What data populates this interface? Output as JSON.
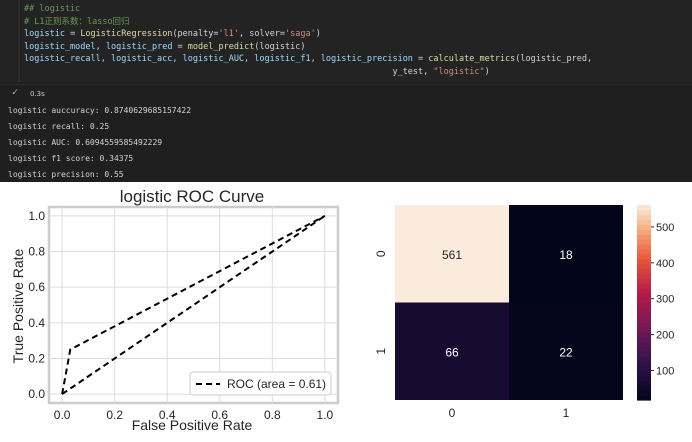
{
  "code": {
    "lines": [
      [
        {
          "t": "## logistic",
          "c": "cm"
        }
      ],
      [
        {
          "t": "# L1正则系数：lasso回归",
          "c": "cm"
        }
      ],
      [
        {
          "t": "logistic",
          "c": "kw"
        },
        {
          "t": " = ",
          "c": "pl"
        },
        {
          "t": "LogisticRegression",
          "c": "fn"
        },
        {
          "t": "(penalty=",
          "c": "pl"
        },
        {
          "t": "'l1'",
          "c": "str"
        },
        {
          "t": ", solver=",
          "c": "pl"
        },
        {
          "t": "'saga'",
          "c": "str"
        },
        {
          "t": ")",
          "c": "pl"
        }
      ],
      [
        {
          "t": "logistic_model",
          "c": "kw"
        },
        {
          "t": ", ",
          "c": "pl"
        },
        {
          "t": "logistic_pred",
          "c": "kw"
        },
        {
          "t": " = ",
          "c": "pl"
        },
        {
          "t": "model_predict",
          "c": "fn"
        },
        {
          "t": "(logistic)",
          "c": "pl"
        }
      ],
      [
        {
          "t": "logistic_recall, logistic_acc, logistic_AUC, logistic_f1, logistic_precision",
          "c": "kw"
        },
        {
          "t": " = ",
          "c": "pl"
        },
        {
          "t": "calculate_metrics",
          "c": "fn"
        },
        {
          "t": "(logistic_pred,",
          "c": "pl"
        }
      ],
      [
        {
          "t": "                                                                        y_test, ",
          "c": "pl"
        },
        {
          "t": "\"logistic\"",
          "c": "str"
        },
        {
          "t": ")",
          "c": "pl"
        }
      ]
    ]
  },
  "status": {
    "time": "0.3s"
  },
  "output": {
    "lines": [
      "logistic auccuracy: 0.8740629685157422",
      "logistic recall: 0.25",
      "logistic AUC: 0.6094559585492229",
      "logistic f1 score: 0.34375",
      "logistic precision: 0.55"
    ]
  },
  "chart_data": [
    {
      "type": "line",
      "title": "logistic ROC Curve",
      "xlabel": "False Positive Rate",
      "ylabel": "True Positive Rate",
      "xlim": [
        -0.05,
        1.05
      ],
      "ylim": [
        -0.05,
        1.05
      ],
      "xticks": [
        "0.0",
        "0.2",
        "0.4",
        "0.6",
        "0.8",
        "1.0"
      ],
      "yticks": [
        "0.0",
        "0.2",
        "0.4",
        "0.6",
        "0.8",
        "1.0"
      ],
      "grid": true,
      "legend_position": "lower-right",
      "series": [
        {
          "name": "ROC (area = 0.61)",
          "x": [
            0,
            0.031,
            1
          ],
          "y": [
            0,
            0.25,
            1
          ],
          "style": "dashed"
        },
        {
          "x": [
            0,
            1
          ],
          "y": [
            0,
            1
          ],
          "style": "dashed"
        }
      ]
    },
    {
      "type": "heatmap",
      "x_categories": [
        "0",
        "1"
      ],
      "y_categories": [
        "0",
        "1"
      ],
      "values": [
        [
          561,
          18
        ],
        [
          66,
          22
        ]
      ],
      "colorbar_ticks": [
        "100",
        "200",
        "300",
        "400",
        "500"
      ],
      "colorbar_range": [
        18,
        561
      ]
    }
  ]
}
